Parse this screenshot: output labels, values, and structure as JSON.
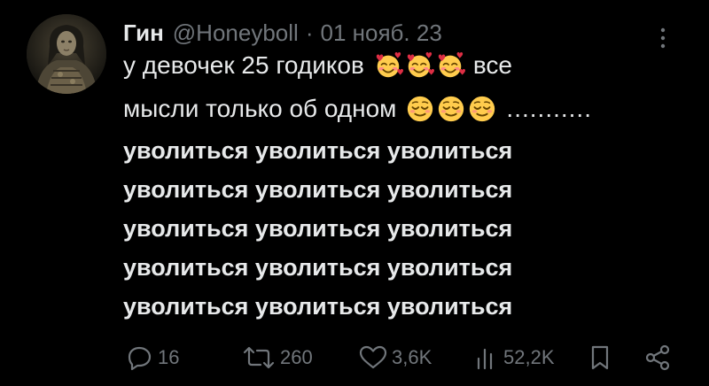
{
  "tweet": {
    "author_name": "Гин",
    "handle": "@Honeyboll",
    "separator": "·",
    "date": "01 нояб. 23",
    "text_line1_before": "у девочек 25 годиков",
    "text_line1_after": "все",
    "text_line2_before": "мысли только об одном",
    "text_line2_after": "...........",
    "emoji_line1": "smiling-face-with-hearts",
    "emoji_line2": "relieved-face",
    "bold_lines": [
      "уволиться уволиться уволиться",
      "уволиться уволиться уволиться",
      "уволиться уволиться уволиться",
      "уволиться уволиться уволиться",
      "уволиться уволиться уволиться"
    ]
  },
  "actions": {
    "replies": "16",
    "retweets": "260",
    "likes": "3,6K",
    "views": "52,2K"
  },
  "colors": {
    "background": "#000000",
    "text": "#e7e9ea",
    "secondary": "#71767b"
  }
}
